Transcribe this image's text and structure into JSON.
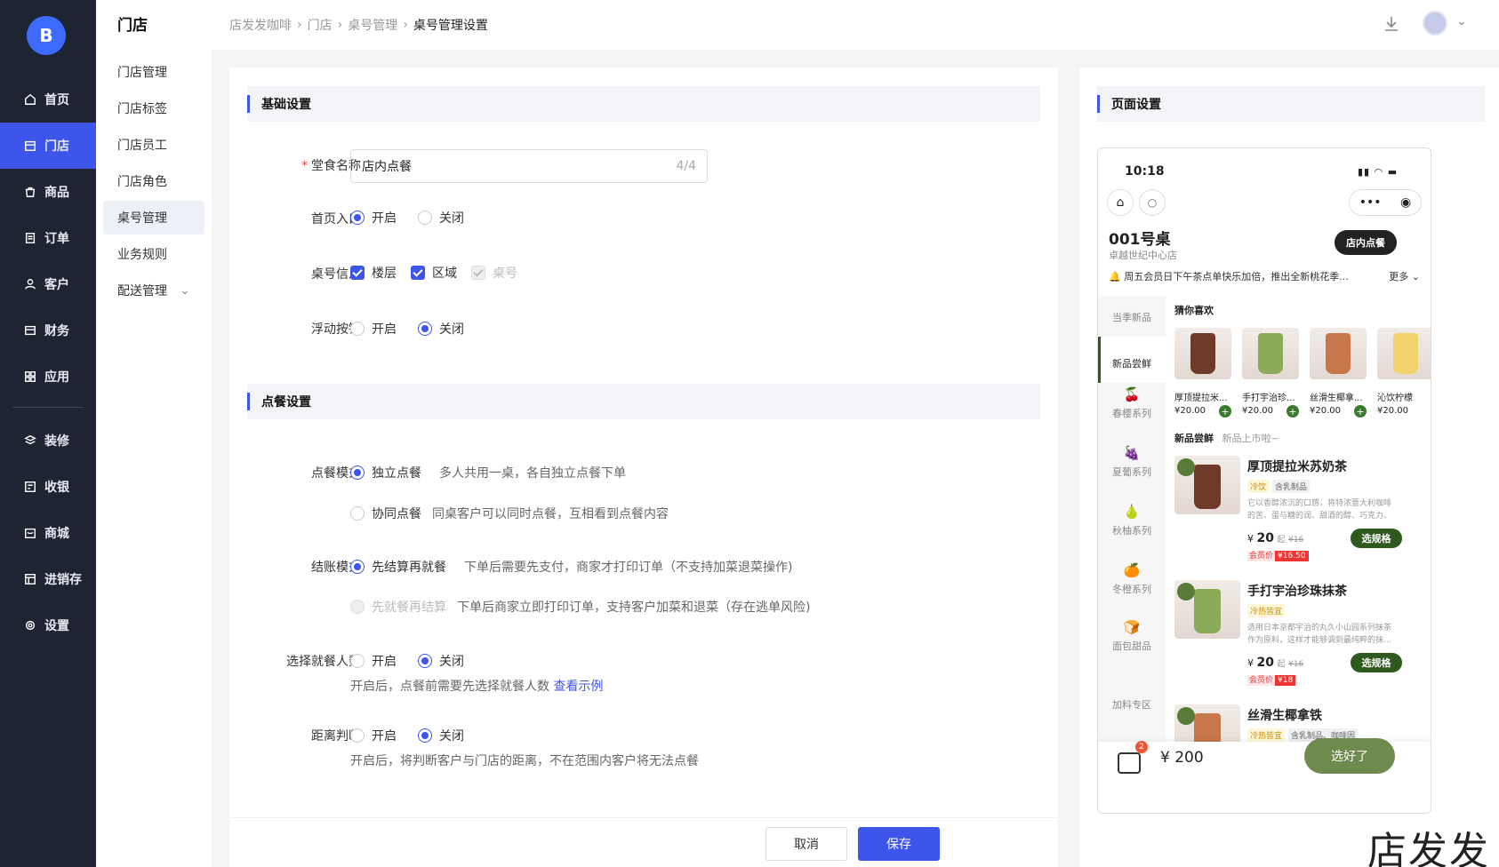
{
  "nav": {
    "logo": "B",
    "items": [
      {
        "label": "首页",
        "icon": "home-icon"
      },
      {
        "label": "门店",
        "icon": "store-icon"
      },
      {
        "label": "商品",
        "icon": "bag-icon"
      },
      {
        "label": "订单",
        "icon": "order-icon"
      },
      {
        "label": "客户",
        "icon": "user-icon"
      },
      {
        "label": "财务",
        "icon": "wallet-icon"
      },
      {
        "label": "应用",
        "icon": "apps-icon"
      },
      {
        "label": "装修",
        "icon": "layers-icon"
      },
      {
        "label": "收银",
        "icon": "cashier-icon"
      },
      {
        "label": "商城",
        "icon": "mall-icon"
      },
      {
        "label": "进销存",
        "icon": "inventory-icon"
      },
      {
        "label": "设置",
        "icon": "settings-icon"
      }
    ],
    "active": "门店"
  },
  "submenu": {
    "title": "门店",
    "items": [
      "门店管理",
      "门店标签",
      "门店员工",
      "门店角色",
      "桌号管理",
      "业务规则",
      "配送管理"
    ],
    "active": "桌号管理"
  },
  "breadcrumb": [
    "店发发咖啡",
    "门店",
    "桌号管理",
    "桌号管理设置"
  ],
  "basic": {
    "title": "基础设置",
    "name_label": "堂食名称",
    "name_value": "店内点餐",
    "name_count": "4/4",
    "entry_label": "首页入口",
    "table_info_label": "桌号信息",
    "floor": "楼层",
    "area": "区域",
    "table_no": "桌号",
    "float_label": "浮动按钮",
    "on": "开启",
    "off": "关闭"
  },
  "order": {
    "title": "点餐设置",
    "mode_label": "点餐模式",
    "mode_a": "独立点餐",
    "mode_a_hint": "多人共用一桌，各自独立点餐下单",
    "mode_b": "协同点餐",
    "mode_b_hint": "同桌客户可以同时点餐，互相看到点餐内容",
    "pay_label": "结账模式",
    "pay_a": "先结算再就餐",
    "pay_a_hint": "下单后需要先支付，商家才打印订单（不支持加菜退菜操作)",
    "pay_b": "先就餐再结算",
    "pay_b_hint": "下单后商家立即打印订单，支持客户加菜和退菜（存在逃单风险)",
    "people_label": "选择就餐人数",
    "people_hint": "开启后，点餐前需要先选择就餐人数",
    "people_link": "查看示例",
    "dist_label": "距离判断",
    "dist_hint": "开启后，将判断客户与门店的距离，不在范围内客户将无法点餐",
    "on": "开启",
    "off": "关闭"
  },
  "footer": {
    "cancel": "取消",
    "save": "保存"
  },
  "preview": {
    "title": "页面设置",
    "time": "10:18",
    "table": "001号桌",
    "store": "卓越世纪中心店",
    "dine_btn": "店内点餐",
    "notice": "周五会员日下午茶点单快乐加倍，推出全新桃花季...",
    "more": "更多",
    "categories": [
      "当季新品",
      "新品尝鲜",
      "春樱系列",
      "夏葡系列",
      "秋柚系列",
      "冬橙系列",
      "面包甜品",
      "加料专区"
    ],
    "guess_title": "猜你喜欢",
    "guess": [
      {
        "name": "厚顶提拉米...",
        "price": "¥20.00"
      },
      {
        "name": "手打宇治珍...",
        "price": "¥20.00"
      },
      {
        "name": "丝滑生椰拿...",
        "price": "¥20.00"
      },
      {
        "name": "沁饮柠檬",
        "price": "¥20.00"
      }
    ],
    "section_title": "新品尝鲜",
    "section_sub": "新品上市啦~",
    "products": [
      {
        "name": "厚顶提拉米苏奶茶",
        "tags": [
          "冷饮",
          "含乳制品"
        ],
        "desc1": "它以香醇浓沉的口感，将特浓薏大利咖啡",
        "desc2": "的苦、蛋与糖的润、甜酒的醇、巧克力、",
        "price": "20",
        "from": "起",
        "old": "¥16",
        "member": "会员价",
        "member_price": "¥16.50",
        "spec": "选规格"
      },
      {
        "name": "手打宇治珍珠抹茶",
        "tags": [
          "冷热皆宜"
        ],
        "desc1": "选用日本京都宇治的丸久小山园系列抹茶",
        "desc2": "作为原料，这样才能够调到最纯粹的抹...",
        "price": "20",
        "from": "起",
        "old": "¥16",
        "member": "会员价",
        "member_price": "¥18",
        "spec": "选规格"
      },
      {
        "name": "丝滑生椰拿铁",
        "tags": [
          "冷热皆宜",
          "含乳制品、咖啡因"
        ]
      }
    ],
    "cart_count": "2",
    "total": "¥ 200",
    "done": "选好了"
  },
  "watermark": "店发发",
  "colors": {
    "accent": "#3d55ea",
    "nav_bg": "#1f2433",
    "green": "#2f5a1f"
  }
}
